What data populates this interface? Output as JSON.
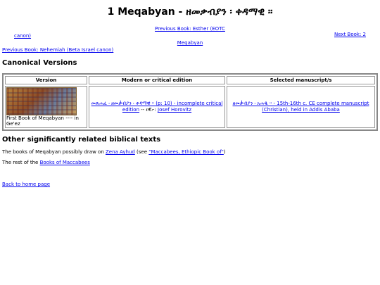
{
  "page": {
    "title": "1 Meqabyan - ዘመቃብያን ፡ ቀዳማዊ ።"
  },
  "nav": {
    "prev_top": "Previous Book: Esther (EOTC canon)",
    "prev_top_part1": "Previous Book: Esther (EOTC",
    "prev_top_part2": "canon)",
    "center_link": "Meqabyan",
    "next": "Next Book: 2",
    "prev_bottom": "Previous Book: Nehemiah (Beta Israel canon)"
  },
  "canonical": {
    "heading": "Canonical Versions",
    "headers": [
      "Version",
      "Modern or critical edition",
      "Selected manuscript/s"
    ],
    "version_caption": "First Book of Meqabyan ---- in Ge'ez",
    "edition_link": "መጽሐፈ ፡ ዘመቃብያን ፡ ቀዳማዊ ። (p: 10) - incomplete critical edition",
    "edition_sep": " -- ዐ€፦: ",
    "edition_author": "Josef Horovitz",
    "manuscript_link": "ዘመቃብያን ፡ አሐዱ ። - 15th-16th c. CE complete manuscript (Christian), held in Addis Ababa"
  },
  "other": {
    "heading": "Other significantly related biblical texts",
    "line1_pre": "The books of Meqabyan possibly draw on ",
    "line1_link1": "Zena Ayhud",
    "line1_mid": " (see ",
    "line1_link2": "\"Maccabees, Ethiopic Book of\"",
    "line1_post": ")",
    "line2_pre": "The rest of the ",
    "line2_link": "Books of Maccabees"
  },
  "footer": {
    "home_link": "Back to home page"
  },
  "colors": {
    "link": "#0000ee",
    "table_border": "#888888"
  }
}
